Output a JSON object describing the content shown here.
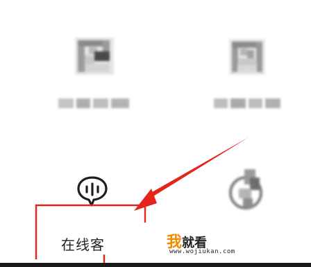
{
  "grid": {
    "tiles": [
      {
        "icon": "pixelated-document-icon"
      },
      {
        "icon": "pixelated-document-icon"
      }
    ]
  },
  "actions": [
    {
      "icon": "chat-voice-icon",
      "label": "在线客"
    },
    {
      "icon": "user-avatar-icon"
    }
  ],
  "annotation": {
    "arrow_color": "#e5241b",
    "box_color": "#e5241b"
  },
  "watermark": {
    "char1": "我",
    "char2": "就看",
    "url": "www.wojiukan.com"
  },
  "colors": {
    "background": "#ffffff",
    "bottom_bar": "#1a1a1a"
  }
}
